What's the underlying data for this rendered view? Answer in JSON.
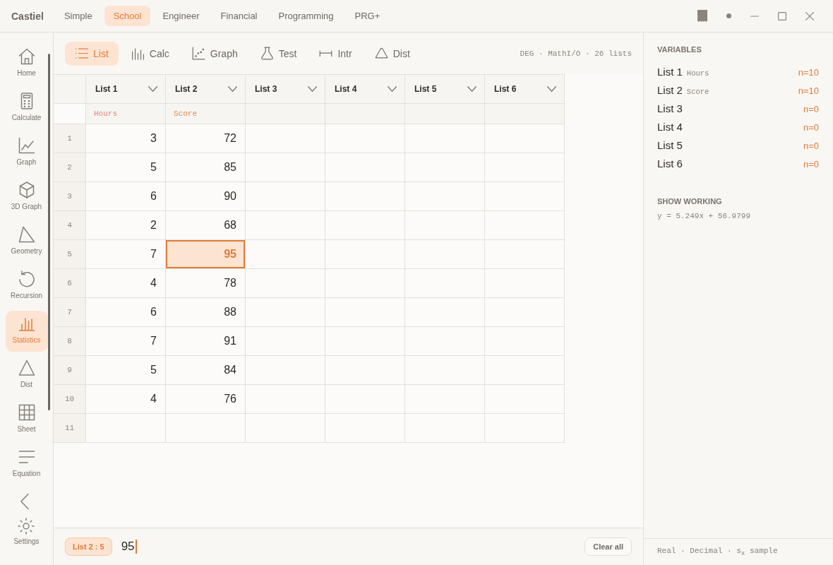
{
  "title_bar": {
    "app_name": "Castiel",
    "modes": [
      {
        "label": "Simple",
        "selected": false
      },
      {
        "label": "School",
        "selected": true
      },
      {
        "label": "Engineer",
        "selected": false
      },
      {
        "label": "Financial",
        "selected": false
      },
      {
        "label": "Programming",
        "selected": false
      },
      {
        "label": "PRG+",
        "selected": false
      }
    ]
  },
  "sidebar": {
    "items": [
      {
        "label": "Home",
        "selected": false
      },
      {
        "label": "Calculate",
        "selected": false
      },
      {
        "label": "Graph",
        "selected": false
      },
      {
        "label": "3D Graph",
        "selected": false
      },
      {
        "label": "Geometry",
        "selected": false
      },
      {
        "label": "Recursion",
        "selected": false
      },
      {
        "label": "Statistics",
        "selected": true
      },
      {
        "label": "Dist",
        "selected": false
      },
      {
        "label": "Sheet",
        "selected": false
      },
      {
        "label": "Equation",
        "selected": false
      }
    ],
    "settings_label": "Settings"
  },
  "toolbar": {
    "tabs": [
      {
        "label": "List",
        "selected": true
      },
      {
        "label": "Calc",
        "selected": false
      },
      {
        "label": "Graph",
        "selected": false
      },
      {
        "label": "Test",
        "selected": false
      },
      {
        "label": "Intr",
        "selected": false
      },
      {
        "label": "Dist",
        "selected": false
      }
    ],
    "status": "DEG · MathI/O · 26 lists"
  },
  "table": {
    "columns": [
      {
        "label": "List 1",
        "name": "Hours",
        "color": "#e4847e"
      },
      {
        "label": "List 2",
        "name": "Score",
        "color": "#e0874a"
      },
      {
        "label": "List 3"
      },
      {
        "label": "List 4"
      },
      {
        "label": "List 5"
      },
      {
        "label": "List 6"
      }
    ],
    "rows": [
      {
        "number": "1",
        "cells": [
          {
            "value": "3",
            "selected": false
          },
          {
            "value": "72",
            "selected": false
          }
        ]
      },
      {
        "number": "2",
        "cells": [
          {
            "value": "5",
            "selected": false
          },
          {
            "value": "85",
            "selected": false
          }
        ]
      },
      {
        "number": "3",
        "cells": [
          {
            "value": "6",
            "selected": false
          },
          {
            "value": "90",
            "selected": false
          }
        ]
      },
      {
        "number": "4",
        "cells": [
          {
            "value": "2",
            "selected": false
          },
          {
            "value": "68",
            "selected": false
          }
        ]
      },
      {
        "number": "5",
        "cells": [
          {
            "value": "7",
            "selected": false
          },
          {
            "value": "95",
            "selected": true
          }
        ]
      },
      {
        "number": "6",
        "cells": [
          {
            "value": "4",
            "selected": false
          },
          {
            "value": "78",
            "selected": false
          }
        ]
      },
      {
        "number": "7",
        "cells": [
          {
            "value": "6",
            "selected": false
          },
          {
            "value": "88",
            "selected": false
          }
        ]
      },
      {
        "number": "8",
        "cells": [
          {
            "value": "7",
            "selected": false
          },
          {
            "value": "91",
            "selected": false
          }
        ]
      },
      {
        "number": "9",
        "cells": [
          {
            "value": "5",
            "selected": false
          },
          {
            "value": "84",
            "selected": false
          }
        ]
      },
      {
        "number": "10",
        "cells": [
          {
            "value": "4",
            "selected": false
          },
          {
            "value": "76",
            "selected": false
          }
        ]
      },
      {
        "number": "11"
      }
    ]
  },
  "entry_bar": {
    "cell_ref": "List 2 : 5",
    "value": "95",
    "clear_label": "Clear all"
  },
  "side_panel": {
    "variables_title": "VARIABLES",
    "variables": [
      {
        "label": "List 1",
        "name": "Hours",
        "count": "n=10"
      },
      {
        "label": "List 2",
        "name": "Score",
        "count": "n=10"
      },
      {
        "label": "List 3",
        "count": "n=0"
      },
      {
        "label": "List 4",
        "count": "n=0"
      },
      {
        "label": "List 5",
        "count": "n=0"
      },
      {
        "label": "List 6",
        "count": "n=0"
      }
    ],
    "working_title": "SHOW WORKING",
    "working": "y = 5.249x + 56.9799",
    "footer": "Real · Decimal · s$_{x}$ sample"
  }
}
